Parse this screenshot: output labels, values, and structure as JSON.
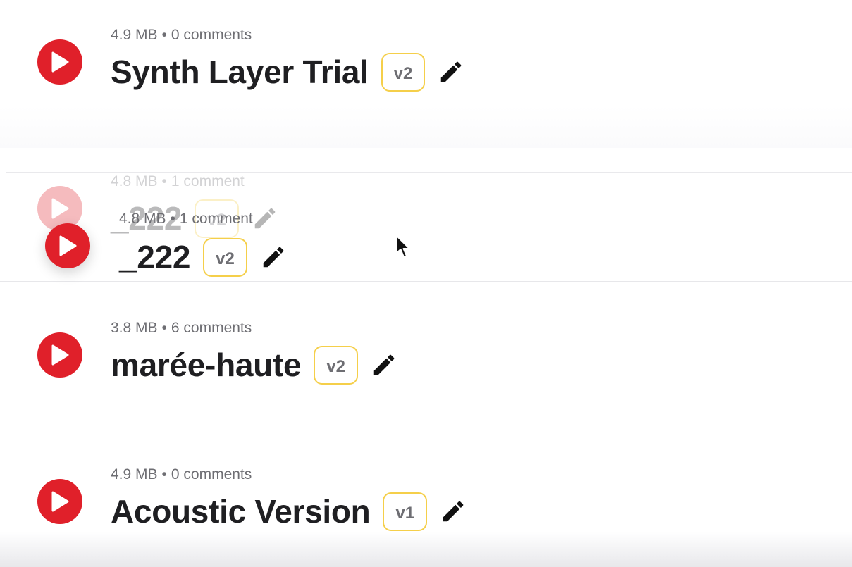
{
  "tracks": [
    {
      "title": "Synth Layer Trial",
      "size": "4.9 MB",
      "comments": "0 comments",
      "version": "v2"
    },
    {
      "title": "_222",
      "size": "4.8 MB",
      "comments": "1 comment",
      "version": "v2"
    },
    {
      "title": "marée-haute",
      "size": "3.8 MB",
      "comments": "6 comments",
      "version": "v2"
    },
    {
      "title": "Acoustic Version",
      "size": "4.9 MB",
      "comments": "0 comments",
      "version": "v1"
    }
  ],
  "dragging": {
    "title": "_222",
    "size": "4.8 MB",
    "comments": "1 comment",
    "version": "v2"
  },
  "separator": "•",
  "icons": {
    "play": "play-icon",
    "edit": "pencil-icon",
    "cursor": "mouse-pointer-icon"
  },
  "colors": {
    "play": "#e0202a",
    "badge_border": "#f5cf4a",
    "meta_text": "#6e6e73",
    "title_text": "#1f1f22"
  }
}
